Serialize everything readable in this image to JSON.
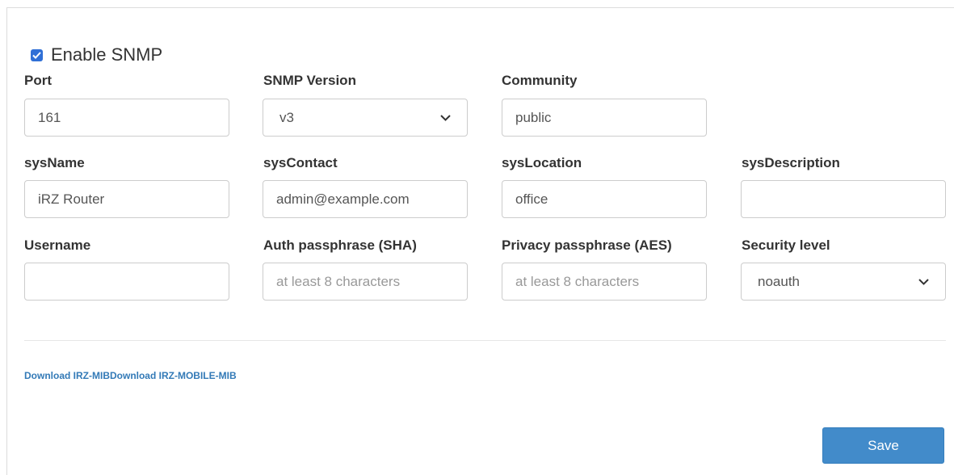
{
  "snmp": {
    "enable_label": "Enable SNMP",
    "enabled": true
  },
  "fields": {
    "port": {
      "label": "Port",
      "value": "161"
    },
    "snmp_version": {
      "label": "SNMP Version",
      "value": "v3"
    },
    "community": {
      "label": "Community",
      "value": "public"
    },
    "sys_name": {
      "label": "sysName",
      "value": "iRZ Router"
    },
    "sys_contact": {
      "label": "sysContact",
      "value": "admin@example.com"
    },
    "sys_location": {
      "label": "sysLocation",
      "value": "office"
    },
    "sys_description": {
      "label": "sysDescription",
      "value": ""
    },
    "username": {
      "label": "Username",
      "value": ""
    },
    "auth_passphrase": {
      "label": "Auth passphrase (SHA)",
      "value": "",
      "placeholder": "at least 8 characters"
    },
    "privacy_passphrase": {
      "label": "Privacy passphrase (AES)",
      "value": "",
      "placeholder": "at least 8 characters"
    },
    "security_level": {
      "label": "Security level",
      "value": "noauth"
    }
  },
  "links": {
    "irz_mib": "Download IRZ-MIB",
    "irz_mobile_mib": "Download IRZ-MOBILE-MIB"
  },
  "actions": {
    "save_label": "Save"
  },
  "colors": {
    "accent": "#428bca",
    "link": "#337ab7",
    "checkbox": "#2f6fd6"
  }
}
